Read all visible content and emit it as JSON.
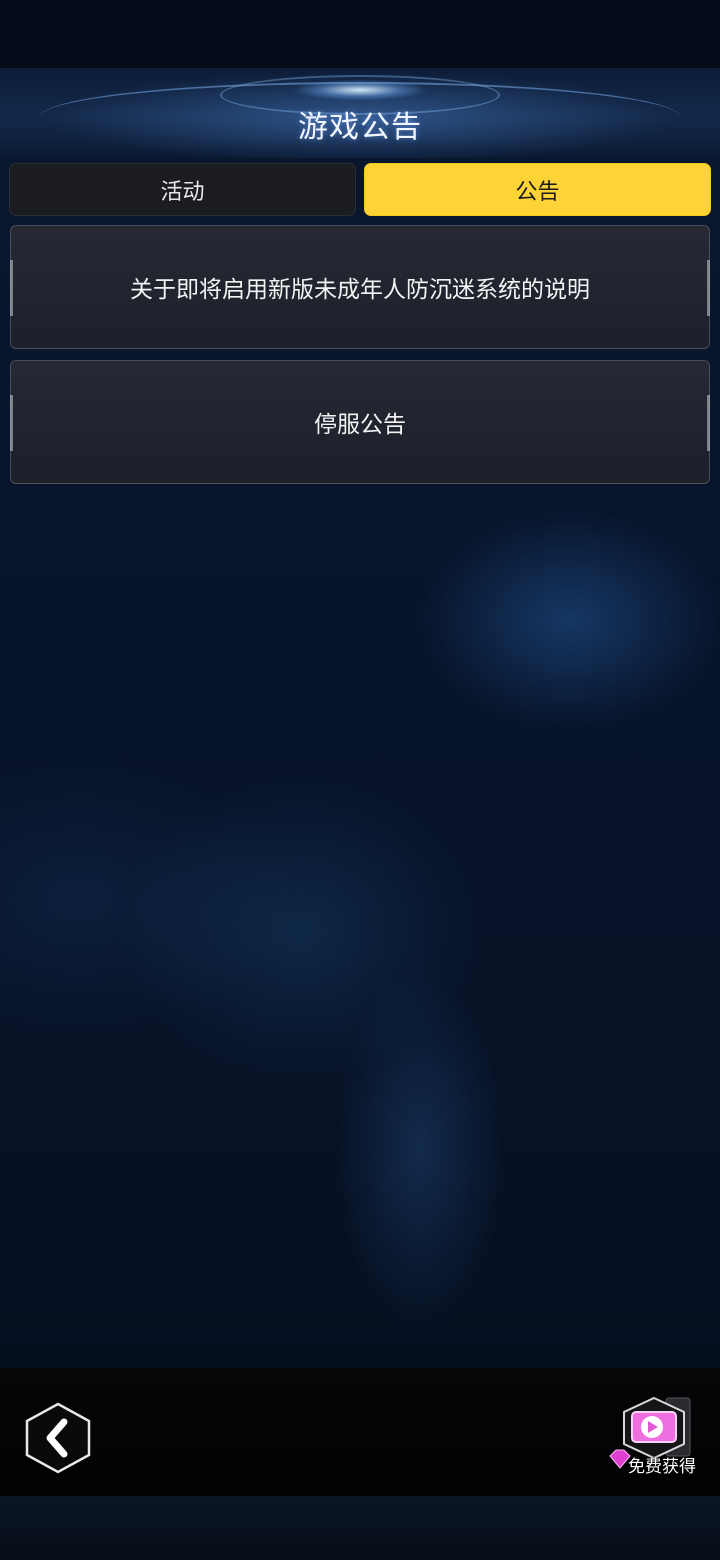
{
  "header": {
    "title": "游戏公告"
  },
  "tabs": [
    {
      "label": "活动",
      "active": false
    },
    {
      "label": "公告",
      "active": true
    }
  ],
  "notices": [
    {
      "title": "关于即将启用新版未成年人防沉迷系统的说明"
    },
    {
      "title": "停服公告"
    }
  ],
  "footer": {
    "back_icon": "chevron-left-icon",
    "reward_icon": "video-play-icon",
    "reward_label": "免费获得"
  },
  "colors": {
    "active_tab": "#fdd335",
    "inactive_tab": "#1a1c21",
    "gem": "#e040d0"
  }
}
